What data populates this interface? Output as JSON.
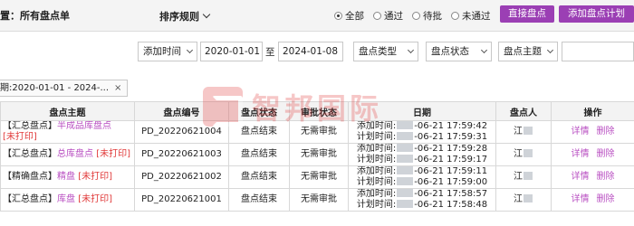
{
  "header": {
    "title": "置：所有盘点单",
    "sort_label": "排序规则",
    "radios": [
      {
        "label": "全部",
        "checked": true
      },
      {
        "label": "通过",
        "checked": false
      },
      {
        "label": "待批",
        "checked": false
      },
      {
        "label": "未通过",
        "checked": false
      }
    ],
    "buttons": {
      "direct": "直接盘点",
      "add_plan": "添加盘点计划"
    },
    "accent_color": "#9b3fb4"
  },
  "filters": {
    "time_type": "添加时间",
    "date_from": "2020-01-01",
    "to_label": "至",
    "date_to": "2024-01-08",
    "stock_type": "盘点类型",
    "stock_status": "盘点状态",
    "stock_theme": "盘点主题",
    "search_value": ""
  },
  "chip": {
    "label": "期:2020-01-01 - 2024-...",
    "close": "×"
  },
  "table": {
    "headers": [
      "盘点主题",
      "盘点编号",
      "盘点状态",
      "审批状态",
      "日期",
      "盘点人",
      "操作"
    ],
    "rows": [
      {
        "type": "【汇总盘点】",
        "theme": "半成品库盘点",
        "print": "[未打印]",
        "code": "PD_20220621004",
        "status": "盘点结束",
        "approval": "无需审批",
        "added": "-06-21 17:59:42",
        "planned": "-06-21 17:59:31",
        "person": "江"
      },
      {
        "type": "【汇总盘点】",
        "theme": "总库盘点",
        "print": "[未打印]",
        "code": "PD_20220621003",
        "status": "盘点结束",
        "approval": "无需审批",
        "added": "-06-21 17:59:28",
        "planned": "-06-21 17:59:17",
        "person": "江"
      },
      {
        "type": "【精确盘点】",
        "theme": "精盘",
        "print": "[未打印]",
        "code": "PD_20220621002",
        "status": "盘点结束",
        "approval": "无需审批",
        "added": "-06-21 17:59:11",
        "planned": "-06-21 17:59:00",
        "person": "江"
      },
      {
        "type": "【汇总盘点】",
        "theme": "库盘",
        "print": "[未打印]",
        "code": "PD_20220621001",
        "status": "盘点结束",
        "approval": "无需审批",
        "added": "-06-21 17:58:57",
        "planned": "-06-21 17:58:48",
        "person": "江"
      }
    ],
    "date_labels": {
      "added": "添加时间:",
      "planned": "计划时间:"
    },
    "actions": {
      "detail": "详情",
      "delete": "删除"
    }
  },
  "watermark": {
    "text": "智邦国际"
  }
}
